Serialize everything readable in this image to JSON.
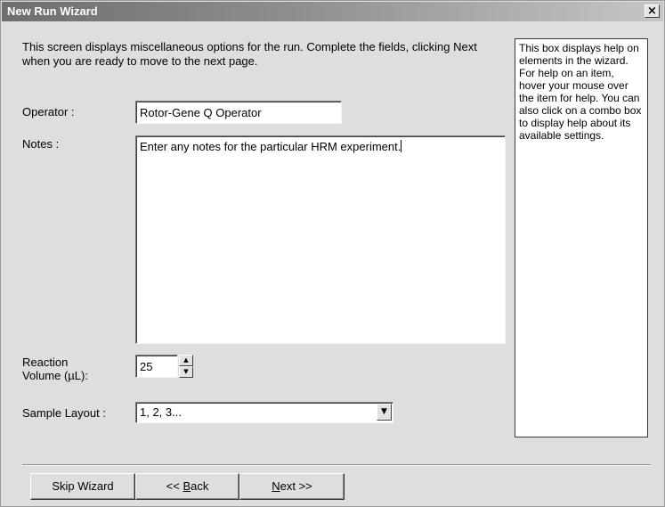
{
  "window": {
    "title": "New Run Wizard",
    "close_glyph": "×"
  },
  "intro_text": "This screen displays miscellaneous options for the run. Complete the fields, clicking Next when you are ready to move to the next page.",
  "operator": {
    "label": "Operator :",
    "value": "Rotor-Gene Q Operator"
  },
  "notes": {
    "label": "Notes :",
    "value": "Enter any notes for the particular HRM experiment."
  },
  "reaction_volume": {
    "label_line1": "Reaction",
    "label_line2": "Volume (µL):",
    "value": "25"
  },
  "sample_layout": {
    "label": "Sample Layout :",
    "selected": "1, 2, 3..."
  },
  "help_text": "This box displays help on elements in the wizard. For help on an item, hover your mouse over the item for help. You can also click on a combo box to display help about its available settings.",
  "buttons": {
    "skip": "Skip Wizard",
    "back_prefix": "<< ",
    "back_key": "B",
    "back_rest": "ack",
    "next_key": "N",
    "next_rest": "ext >>"
  },
  "icons": {
    "spin_up": "up-arrow-icon",
    "spin_down": "down-arrow-icon",
    "combo": "dropdown-arrow-icon"
  }
}
